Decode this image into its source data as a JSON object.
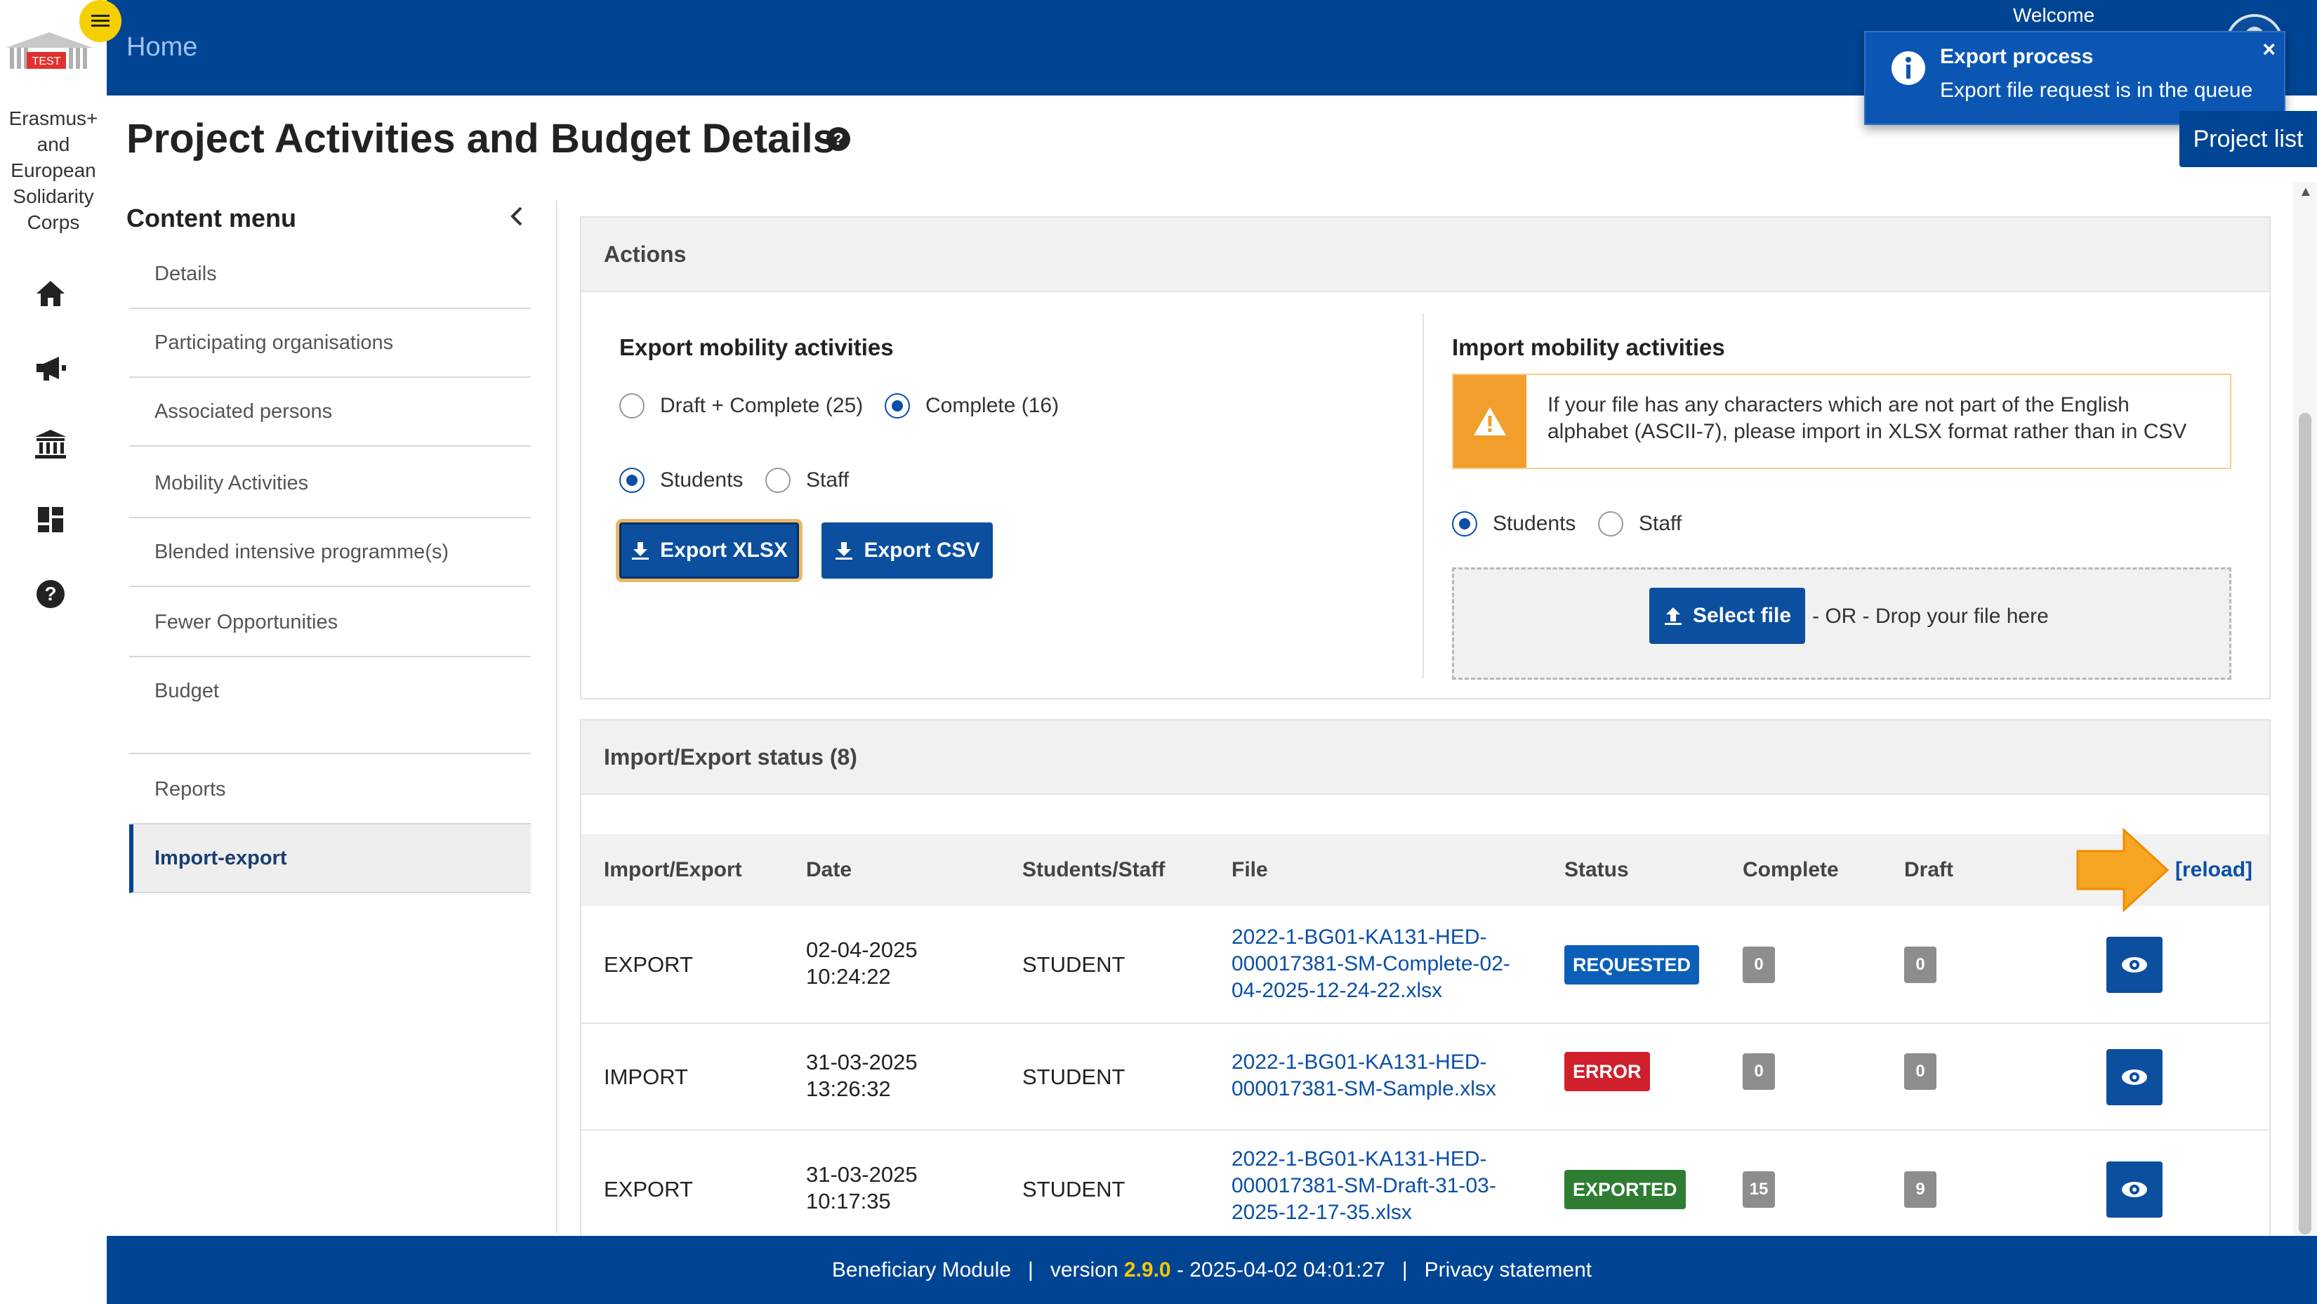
{
  "rail": {
    "logo_text": "TEST",
    "title": "Erasmus+ and European Solidarity Corps",
    "icons": [
      "home-icon",
      "megaphone-icon",
      "institution-icon",
      "dashboard-icon",
      "help-icon"
    ]
  },
  "topbar": {
    "home": "Home",
    "welcome": "Welcome",
    "project_list": "Project list"
  },
  "toast": {
    "title": "Export process",
    "message": "Export file request is in the queue",
    "close": "×"
  },
  "page": {
    "title": "Project Activities and Budget Details"
  },
  "menu": {
    "title": "Content menu",
    "items": [
      "Details",
      "Participating organisations",
      "Associated persons",
      "Mobility Activities",
      "Blended intensive programme(s)",
      "Fewer Opportunities",
      "Budget",
      "Reports",
      "Import-export"
    ]
  },
  "actions": {
    "title": "Actions",
    "export": {
      "title": "Export mobility activities",
      "scope_options": [
        "Draft + Complete (25)",
        "Complete (16)"
      ],
      "scope_selected": "Complete (16)",
      "type_options": [
        "Students",
        "Staff"
      ],
      "type_selected": "Students",
      "xlsx_label": "Export XLSX",
      "csv_label": "Export CSV"
    },
    "import": {
      "title": "Import mobility activities",
      "warning_line1": "If your file has any characters which are not part of the English",
      "warning_line2": "alphabet (ASCII-7), please import in XLSX format rather than in CSV",
      "type_options": [
        "Students",
        "Staff"
      ],
      "type_selected": "Students",
      "select_file": "Select file",
      "drop_text": "- OR - Drop your file here"
    }
  },
  "status": {
    "title": "Import/Export status (8)",
    "reload": "[reload]",
    "columns": [
      "Import/Export",
      "Date",
      "Students/Staff",
      "File",
      "Status",
      "Complete",
      "Draft"
    ],
    "rows": [
      {
        "type": "EXPORT",
        "date": "02-04-2025",
        "time": "10:24:22",
        "who": "STUDENT",
        "file_lines": [
          "2022-1-BG01-KA131-HED-",
          "000017381-SM-Complete-02-",
          "04-2025-12-24-22.xlsx"
        ],
        "status": "REQUESTED",
        "status_color": "#0b5fb8",
        "complete": "0",
        "draft": "0"
      },
      {
        "type": "IMPORT",
        "date": "31-03-2025",
        "time": "13:26:32",
        "who": "STUDENT",
        "file_lines": [
          "2022-1-BG01-KA131-HED-",
          "000017381-SM-Sample.xlsx"
        ],
        "status": "ERROR",
        "status_color": "#d0202e",
        "complete": "0",
        "draft": "0"
      },
      {
        "type": "EXPORT",
        "date": "31-03-2025",
        "time": "10:17:35",
        "who": "STUDENT",
        "file_lines": [
          "2022-1-BG01-KA131-HED-",
          "000017381-SM-Draft-31-03-",
          "2025-12-17-35.xlsx"
        ],
        "status": "EXPORTED",
        "status_color": "#2e7d32",
        "complete": "15",
        "draft": "9"
      }
    ]
  },
  "footer": {
    "module": "Beneficiary Module",
    "sep": "|",
    "version_prefix": "version",
    "version": "2.9.0",
    "version_date": "- 2025-04-02 04:01:27",
    "privacy": "Privacy statement"
  },
  "colors": {
    "brand": "#004494",
    "accent": "#f5d000",
    "button": "#0b4f9e",
    "arrow": "#f6a623"
  }
}
